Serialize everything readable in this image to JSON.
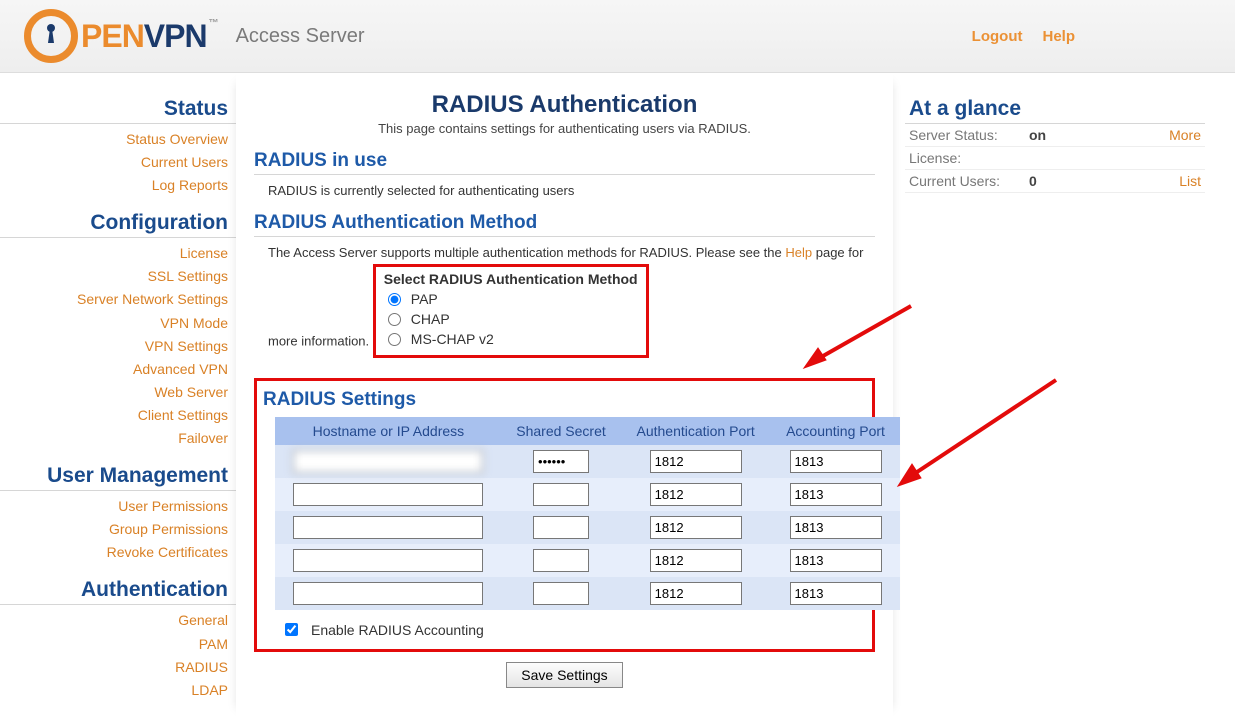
{
  "header": {
    "logo_pen": "PEN",
    "logo_vpn": "VPN",
    "tm": "™",
    "subtitle": "Access Server",
    "logout": "Logout",
    "help": "Help"
  },
  "sidebar": {
    "sections": [
      {
        "title": "Status",
        "links": [
          "Status Overview",
          "Current Users",
          "Log Reports"
        ]
      },
      {
        "title": "Configuration",
        "links": [
          "License",
          "SSL Settings",
          "Server Network Settings",
          "VPN Mode",
          "VPN Settings",
          "Advanced VPN",
          "Web Server",
          "Client Settings",
          "Failover"
        ]
      },
      {
        "title": "User Management",
        "links": [
          "User Permissions",
          "Group Permissions",
          "Revoke Certificates"
        ]
      },
      {
        "title": "Authentication",
        "links": [
          "General",
          "PAM",
          "RADIUS",
          "LDAP"
        ]
      }
    ]
  },
  "page": {
    "title": "RADIUS Authentication",
    "description": "This page contains settings for authenticating users via RADIUS."
  },
  "radius_in_use": {
    "heading": "RADIUS in use",
    "text": "RADIUS is currently selected for authenticating users"
  },
  "auth_method": {
    "heading": "RADIUS Authentication Method",
    "text_before": "The Access Server supports multiple authentication methods for RADIUS. Please see the ",
    "help_link": "Help",
    "text_after": " page for more information.",
    "select_label": "Select RADIUS Authentication Method",
    "options": [
      "PAP",
      "CHAP",
      "MS-CHAP v2"
    ],
    "selected": "PAP"
  },
  "settings": {
    "heading": "RADIUS Settings",
    "columns": [
      "Hostname or IP Address",
      "Shared Secret",
      "Authentication Port",
      "Accounting Port"
    ],
    "rows": [
      {
        "host": "",
        "host_blurred": true,
        "secret": "••••••",
        "auth_port": "1812",
        "acct_port": "1813"
      },
      {
        "host": "",
        "host_blurred": false,
        "secret": "",
        "auth_port": "1812",
        "acct_port": "1813"
      },
      {
        "host": "",
        "host_blurred": false,
        "secret": "",
        "auth_port": "1812",
        "acct_port": "1813"
      },
      {
        "host": "",
        "host_blurred": false,
        "secret": "",
        "auth_port": "1812",
        "acct_port": "1813"
      },
      {
        "host": "",
        "host_blurred": false,
        "secret": "",
        "auth_port": "1812",
        "acct_port": "1813"
      }
    ],
    "enable_accounting_label": "Enable RADIUS Accounting",
    "enable_accounting": true,
    "save_button": "Save Settings"
  },
  "glance": {
    "title": "At a glance",
    "rows": [
      {
        "label": "Server Status:",
        "value": "on",
        "link": "More"
      },
      {
        "label": "License:",
        "value": "          ",
        "link": "",
        "value_blurred": true
      },
      {
        "label": "Current Users:",
        "value": "0",
        "link": "List"
      }
    ]
  }
}
